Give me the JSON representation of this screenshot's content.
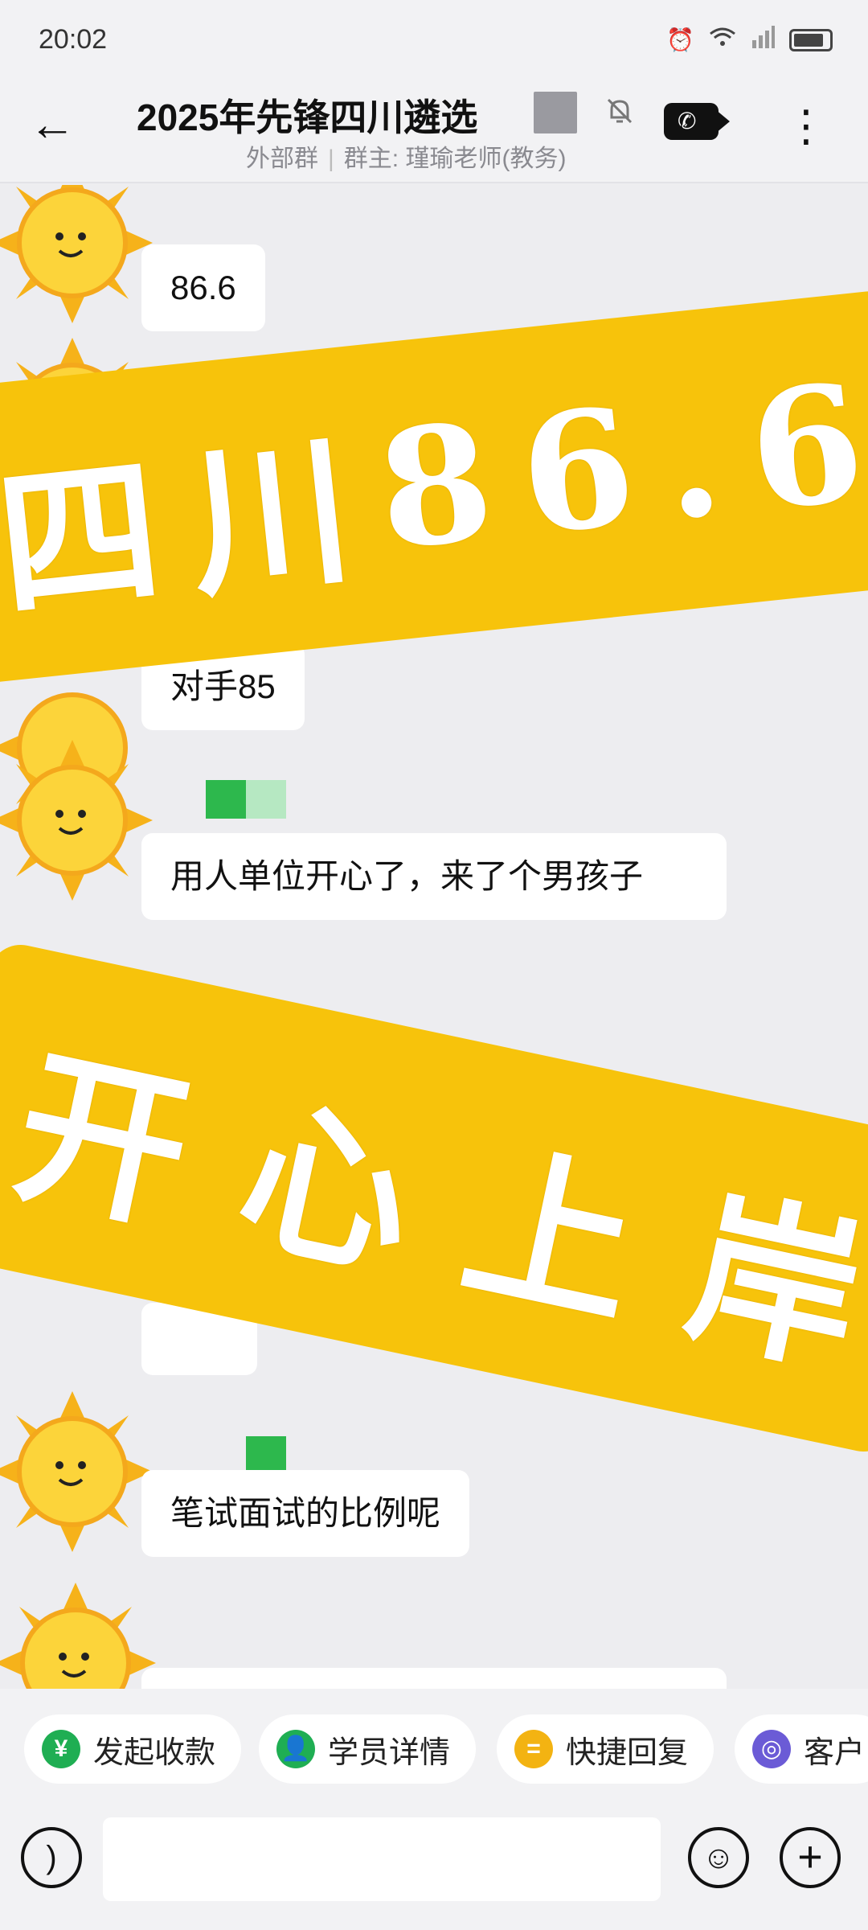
{
  "status_bar": {
    "time": "20:02",
    "icons": [
      "alarm-icon",
      "wifi-icon",
      "signal-icon",
      "battery-icon"
    ]
  },
  "header": {
    "title": "2025年先锋四川遴选",
    "subtitle_type": "外部群",
    "subtitle_owner": "群主: 瑾瑜老师(教务)",
    "icons": [
      "back-arrow-icon",
      "mute-bell-icon",
      "video-call-icon",
      "more-icon"
    ]
  },
  "messages": [
    {
      "text": "86.6"
    },
    {
      "text": "对手85"
    },
    {
      "text": "用人单位开心了，来了个男孩子"
    },
    {
      "text": "笔试面试的比例呢"
    }
  ],
  "banners": [
    {
      "text": "四川86.6",
      "chars": [
        "四",
        "川",
        "8",
        "6",
        ".",
        "6"
      ]
    },
    {
      "text": "开心上岸",
      "chars": [
        "开",
        "心",
        "上",
        "岸"
      ]
    }
  ],
  "quick_actions": [
    {
      "label": "发起收款",
      "icon": "payment-icon",
      "color": "#1fae53"
    },
    {
      "label": "学员详情",
      "icon": "student-icon",
      "color": "#1fae53"
    },
    {
      "label": "快捷回复",
      "icon": "quick-reply-icon",
      "color": "#f3b312"
    },
    {
      "label": "客户",
      "icon": "customer-icon",
      "color": "#6b5bd6"
    }
  ],
  "input": {
    "placeholder": ""
  },
  "colors": {
    "banner_yellow": "#f7c30b",
    "chat_background": "#ededf0",
    "bubble": "#ffffff"
  }
}
